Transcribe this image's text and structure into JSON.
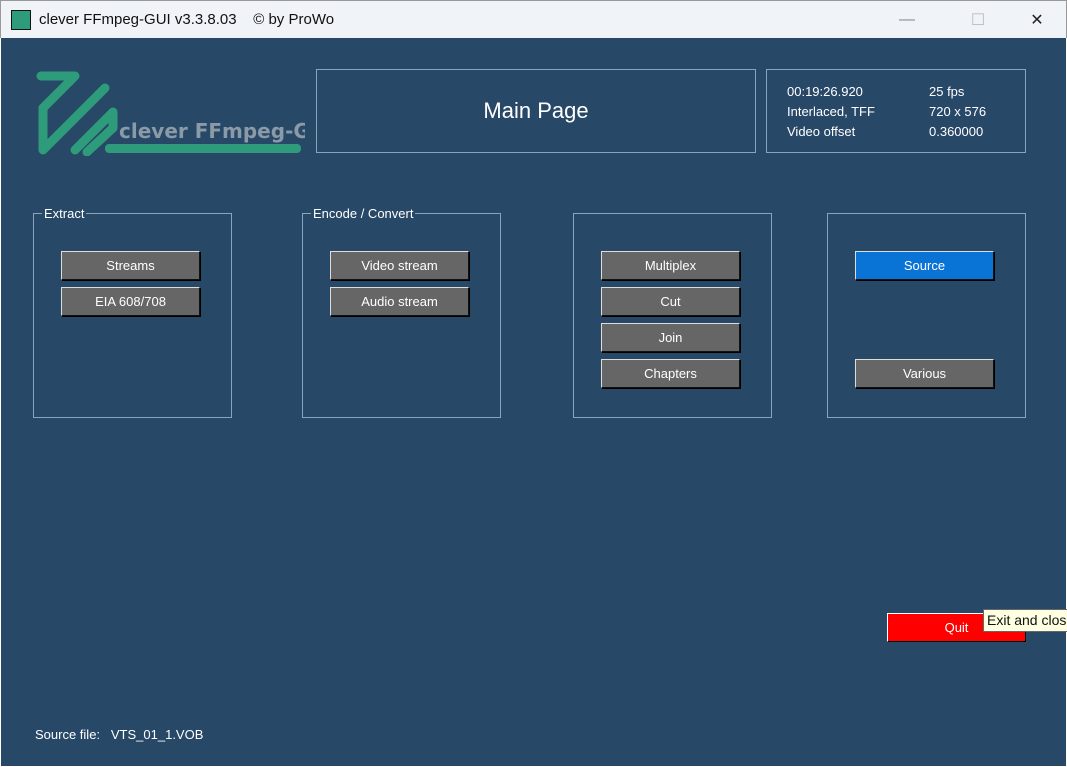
{
  "window": {
    "title": "clever FFmpeg-GUI v3.3.8.03    © by ProWo",
    "minimize": "—",
    "maximize": "☐",
    "close": "✕"
  },
  "logo": {
    "text": "clever FFmpeg-GUI"
  },
  "header": {
    "title": "Main Page"
  },
  "info": {
    "duration": "00:19:26.920",
    "fps": "25 fps",
    "scan": "Interlaced, TFF",
    "resolution": "720 x 576",
    "offset_label": "Video offset",
    "offset_value": "0.360000"
  },
  "groups": {
    "extract": {
      "label": "Extract",
      "buttons": [
        "Streams",
        "EIA 608/708"
      ]
    },
    "encode": {
      "label": "Encode / Convert",
      "buttons": [
        "Video stream",
        "Audio stream"
      ]
    },
    "mux": {
      "buttons": [
        "Multiplex",
        "Cut",
        "Join",
        "Chapters"
      ]
    },
    "misc": {
      "buttons": [
        "Source",
        "Various"
      ]
    }
  },
  "quit": {
    "label": "Quit",
    "tooltip": "Exit and close"
  },
  "status": {
    "source_label": "Source file:",
    "source_value": "VTS_01_1.VOB"
  },
  "colors": {
    "background": "#284868",
    "quit": "#ff0000",
    "source_active": "#0a74d6",
    "logo": "#2e9c7a"
  }
}
